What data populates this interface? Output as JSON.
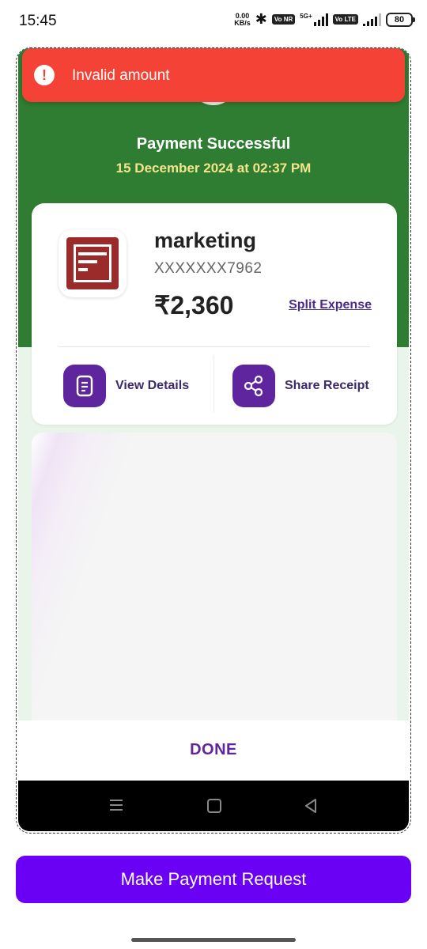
{
  "status_bar": {
    "time": "15:45",
    "speed_value": "0.00",
    "speed_unit": "KB/s",
    "network_label_1": "5G+",
    "volte_1": "Vo NR",
    "volte_2": "Vo LTE",
    "battery": "80"
  },
  "toast": {
    "icon": "!",
    "message": "Invalid amount",
    "color": "#f44336"
  },
  "receipt": {
    "status_title": "Payment Successful",
    "date": "15 December 2024 at 02:37 PM",
    "payee_name": "marketing",
    "account": "XXXXXXX7962",
    "amount": "₹2,360",
    "split_link": "Split Expense",
    "actions": [
      {
        "label": "View Details",
        "icon": "document-icon"
      },
      {
        "label": "Share Receipt",
        "icon": "share-icon"
      }
    ],
    "done_label": "DONE"
  },
  "main": {
    "make_request_label": "Make Payment Request"
  },
  "colors": {
    "success_green": "#2e7d32",
    "brand_purple": "#5f259f",
    "cta_purple": "#6a00f4",
    "date_yellow": "#f4e58a"
  }
}
